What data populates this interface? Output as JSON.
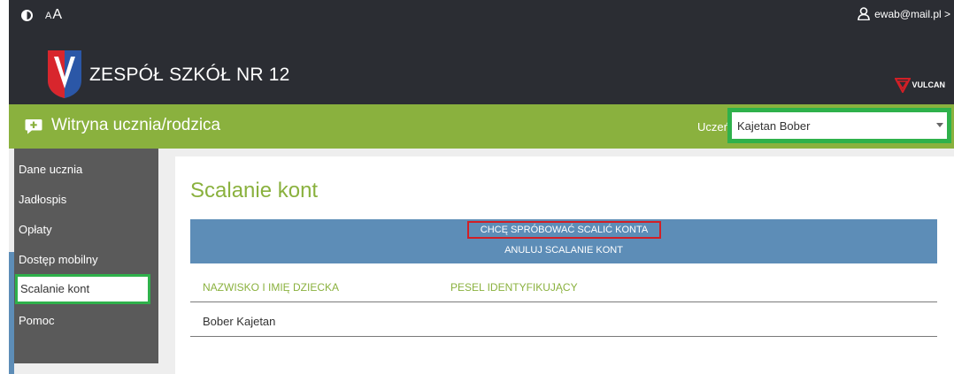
{
  "header": {
    "font_size_small": "A",
    "font_size_big": "A",
    "user_email": "ewab@mail.pl >",
    "school_name": "ZESPÓŁ SZKÓŁ NR 12",
    "logo_letter": "V",
    "vendor": "VULCAN"
  },
  "titlebar": {
    "title": "Witryna ucznia/rodzica",
    "student_label": "Uczeń:",
    "student_selected": "Kajetan Bober"
  },
  "sidebar": {
    "items": [
      {
        "label": "Dane ucznia"
      },
      {
        "label": "Jadłospis"
      },
      {
        "label": "Opłaty"
      },
      {
        "label": "Dostęp mobilny"
      },
      {
        "label": "Scalanie kont"
      },
      {
        "label": "Pomoc"
      }
    ],
    "active_index": 4
  },
  "main": {
    "title": "Scalanie kont",
    "merge_button": "CHCĘ SPRÓBOWAĆ SCALIĆ KONTA",
    "cancel_button": "ANULUJ SCALANIE KONT",
    "columns": [
      "NAZWISKO I IMIĘ DZIECKA",
      "PESEL IDENTYFIKUJĄCY"
    ],
    "rows": [
      {
        "name": "Bober Kajetan",
        "pesel": ""
      }
    ]
  },
  "colors": {
    "dark_header": "#2b2d33",
    "brand_green": "#8ab13e",
    "highlight_green": "#2fb14b",
    "highlight_red": "#d21f26",
    "action_blue": "#5d8db7",
    "sidebar_gray": "#5a5a5a"
  },
  "icons": [
    "contrast-icon",
    "user-icon",
    "school-logo",
    "vulcan-logo",
    "witryna-icon",
    "caret-down-icon"
  ]
}
